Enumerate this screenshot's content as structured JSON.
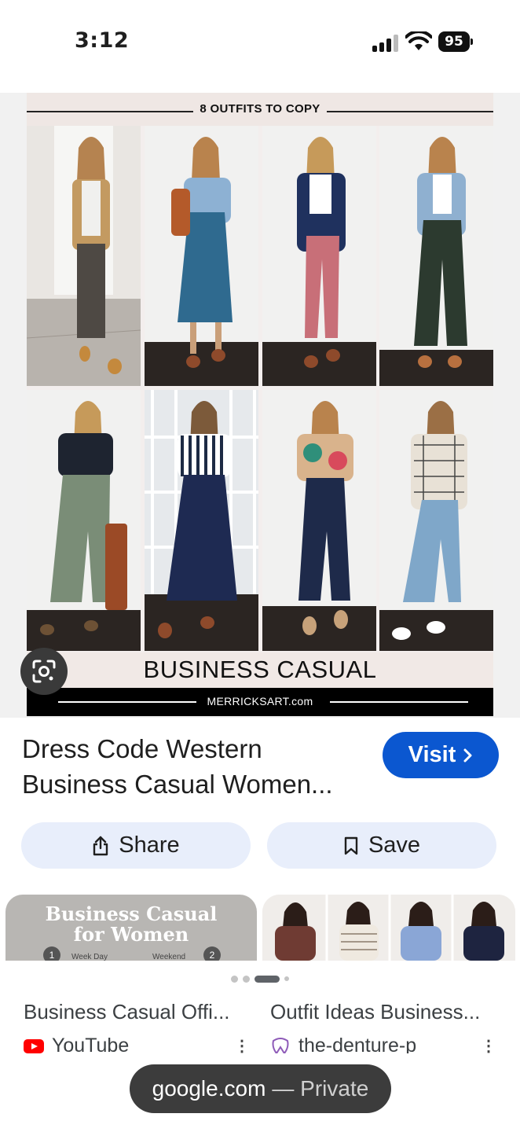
{
  "status_bar": {
    "time": "3:12",
    "battery": "95"
  },
  "hero_image": {
    "header_text": "8 OUTFITS TO COPY",
    "caption": "BUSINESS CASUAL",
    "site": "MERRICKSART.com"
  },
  "result": {
    "title_line1": "Dress Code Western",
    "title_line2": "Business Casual Women...",
    "visit_label": "Visit",
    "share_label": "Share",
    "save_label": "Save"
  },
  "related": [
    {
      "thumb_title_line1": "Business Casual",
      "thumb_title_line2": "for Women",
      "thumb_left_label": "Week Day",
      "thumb_right_label": "Weekend",
      "thumb_left_num": "1",
      "thumb_right_num": "2",
      "caption": "Business Casual Offi...",
      "source": "YouTube"
    },
    {
      "caption": "Outfit Ideas Business...",
      "source": "the-denture-p"
    }
  ],
  "browser": {
    "domain": "google.com",
    "mode": "— Private"
  },
  "icons": [
    "lens-icon",
    "share-icon",
    "bookmark-icon",
    "chevron-right-icon",
    "youtube-icon",
    "more-vert-icon"
  ],
  "colors": {
    "visit_button": "#0b57d0",
    "action_button_bg": "#e8eefb",
    "url_pill": "#3c3c3c"
  }
}
